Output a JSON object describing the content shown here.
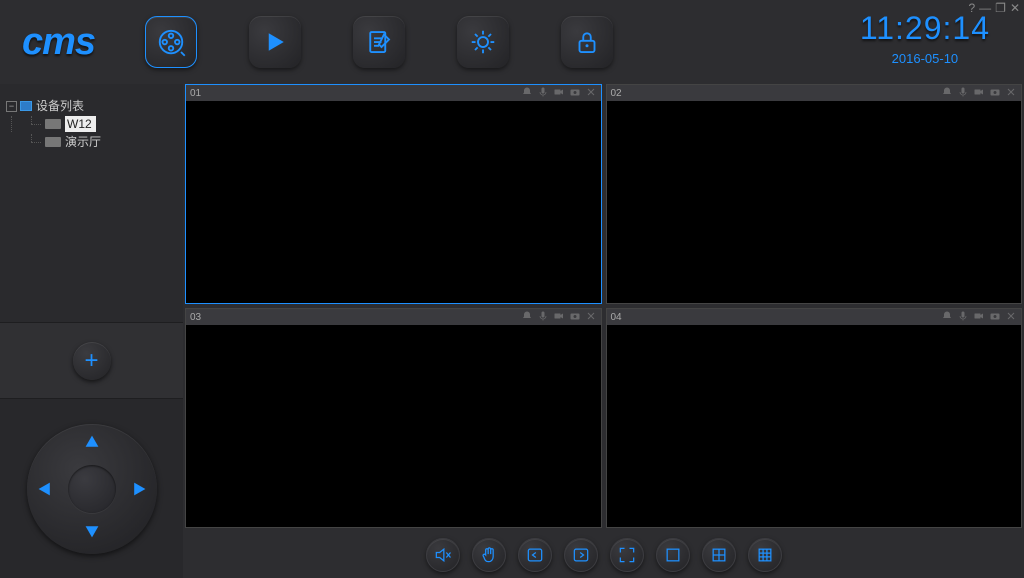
{
  "titlebar": {
    "help": "?",
    "min": "—",
    "max": "❐",
    "close": "✕"
  },
  "logo": "cms",
  "clock": {
    "time": "11:29:14",
    "date": "2016-05-10"
  },
  "tree": {
    "root": "设备列表",
    "items": [
      {
        "label": "W12",
        "selected": true
      },
      {
        "label": "演示厅",
        "selected": false
      }
    ]
  },
  "add_btn": "+",
  "panes": [
    {
      "num": "01",
      "active": true
    },
    {
      "num": "02",
      "active": false
    },
    {
      "num": "03",
      "active": false
    },
    {
      "num": "04",
      "active": false
    }
  ]
}
